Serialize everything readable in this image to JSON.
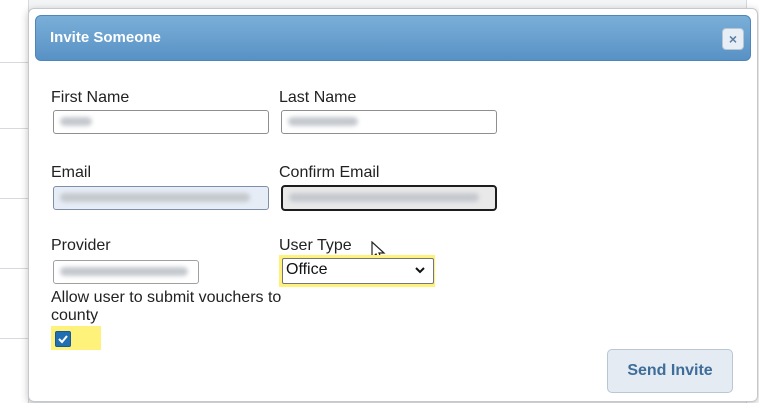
{
  "dialog": {
    "title": "Invite Someone",
    "close_label": "×"
  },
  "form": {
    "first_name_label": "First Name",
    "last_name_label": "Last Name",
    "email_label": "Email",
    "confirm_email_label": "Confirm Email",
    "provider_label": "Provider",
    "user_type_label": "User Type",
    "user_type_value": "Office",
    "allow_vouchers_label": "Allow user to submit vouchers to county",
    "allow_vouchers_checked": true
  },
  "actions": {
    "send_invite_label": "Send Invite"
  },
  "colors": {
    "titlebar": "#5f97cb",
    "highlight": "#fff27a",
    "button_text": "#3f6d9a"
  }
}
